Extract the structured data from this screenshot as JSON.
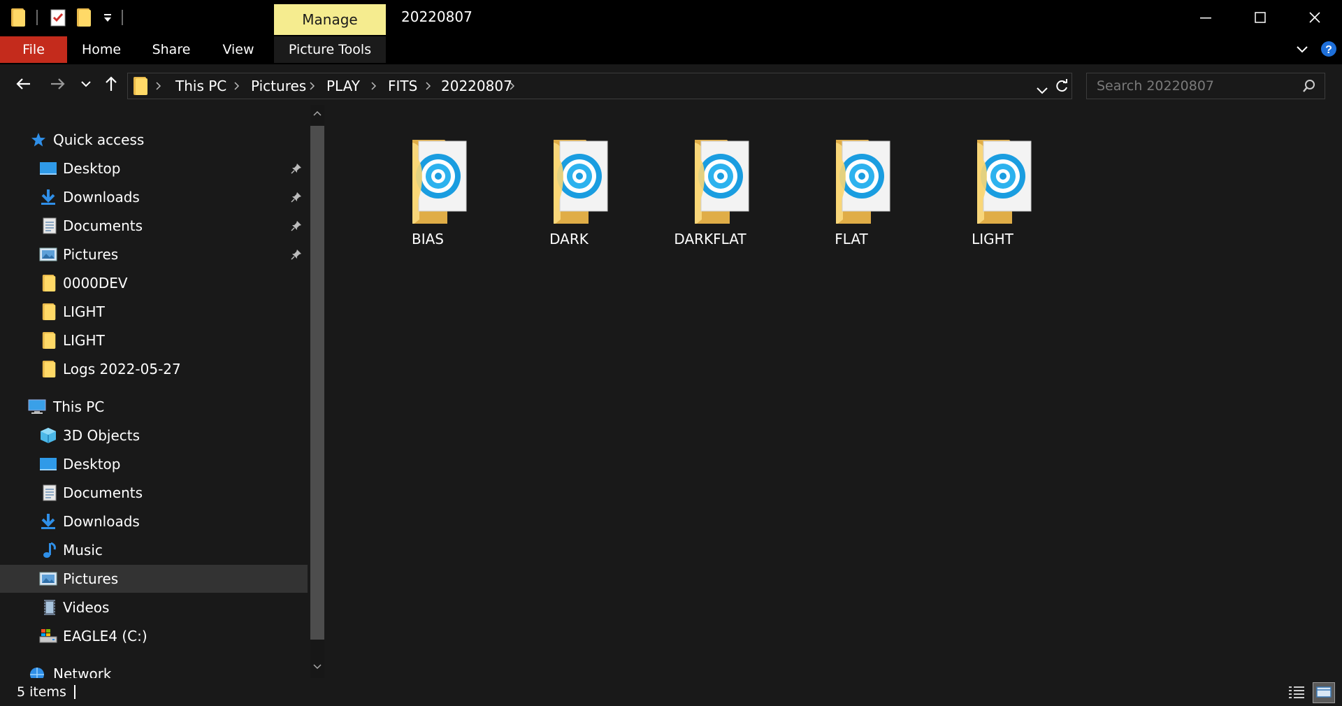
{
  "window": {
    "title": "20220807",
    "context_tab": "Manage",
    "controls": {
      "minimize": "minimize-icon",
      "maximize": "maximize-icon",
      "close": "close-icon"
    }
  },
  "ribbon": {
    "tabs": [
      "File",
      "Home",
      "Share",
      "View",
      "Picture Tools"
    ],
    "accent_file": "#c42b1c",
    "accent_manage": "#f5ec8f"
  },
  "address": {
    "crumbs": [
      "This PC",
      "Pictures",
      "PLAY",
      "FITS",
      "20220807"
    ],
    "search_placeholder": "Search 20220807"
  },
  "sidebar": {
    "quick_access": {
      "label": "Quick access",
      "items": [
        {
          "label": "Desktop",
          "icon": "desktop-icon",
          "pinned": true
        },
        {
          "label": "Downloads",
          "icon": "downloads-icon",
          "pinned": true
        },
        {
          "label": "Documents",
          "icon": "documents-icon",
          "pinned": true
        },
        {
          "label": "Pictures",
          "icon": "pictures-icon",
          "pinned": true
        },
        {
          "label": "0000DEV",
          "icon": "folder-icon",
          "pinned": false
        },
        {
          "label": "LIGHT",
          "icon": "folder-icon",
          "pinned": false
        },
        {
          "label": "LIGHT",
          "icon": "folder-icon",
          "pinned": false
        },
        {
          "label": "Logs 2022-05-27",
          "icon": "folder-icon",
          "pinned": false
        }
      ]
    },
    "this_pc": {
      "label": "This PC",
      "items": [
        {
          "label": "3D Objects",
          "icon": "3d-objects-icon"
        },
        {
          "label": "Desktop",
          "icon": "desktop-icon"
        },
        {
          "label": "Documents",
          "icon": "documents-icon"
        },
        {
          "label": "Downloads",
          "icon": "downloads-icon"
        },
        {
          "label": "Music",
          "icon": "music-icon"
        },
        {
          "label": "Pictures",
          "icon": "pictures-icon",
          "selected": true
        },
        {
          "label": "Videos",
          "icon": "videos-icon"
        },
        {
          "label": "EAGLE4 (C:)",
          "icon": "drive-icon"
        }
      ]
    },
    "network": {
      "label": "Network"
    }
  },
  "content": {
    "folders": [
      "BIAS",
      "DARK",
      "DARKFLAT",
      "FLAT",
      "LIGHT"
    ]
  },
  "status": {
    "item_count": "5 items"
  }
}
